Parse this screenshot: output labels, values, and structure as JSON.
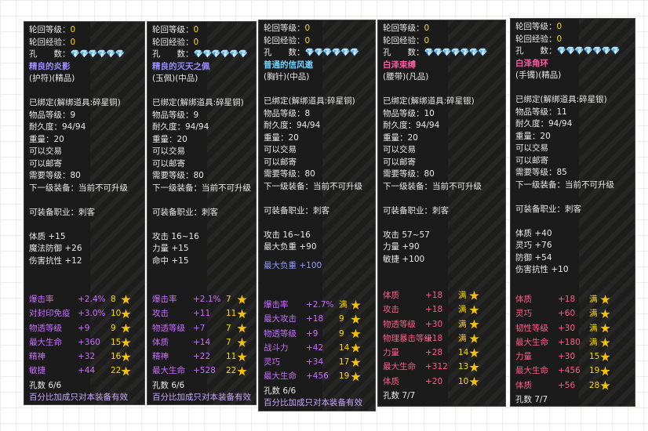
{
  "panels": [
    {
      "lunhui_level": "轮回等级：",
      "lunhui_level_val": "0",
      "lunhui_exp": "轮回经验：",
      "lunhui_exp_val": "0",
      "holes_label": "孔　　数：",
      "holes_stars": "💎💎💎💎💎💎",
      "name": "精良的炎影",
      "name_color": "#9b8cff",
      "type": "(护符)(精品)",
      "lines": [
        "已绑定(解绑道具:碎星铜)",
        "物品等级：9",
        "耐久度：94/94",
        "重量：20",
        "可以交易",
        "可以邮寄",
        "需要等级：80",
        "下一级装备：当前不可升级"
      ],
      "job": "可装备职业：刺客",
      "base": [
        "体质 +15",
        "魔法防御 +26",
        "伤害抗性 +12"
      ],
      "extras": [
        {
          "label": "爆击率",
          "value": "+2.4%",
          "level": "8",
          "color": "#c96bff"
        },
        {
          "label": "对封印免疫",
          "value": "+3.0%",
          "level": "10",
          "color": "#c96bff"
        },
        {
          "label": "物透等级",
          "value": "+9",
          "level": "9",
          "color": "#c96bff"
        },
        {
          "label": "最大生命",
          "value": "+360",
          "level": "15",
          "color": "#c96bff"
        },
        {
          "label": "精神",
          "value": "+32",
          "level": "16",
          "color": "#c96bff"
        },
        {
          "label": "敏捷",
          "value": "+44",
          "level": "22",
          "color": "#c96bff"
        }
      ],
      "holes_count": "孔数 6/6",
      "note": "百分比加成只对本装备有效"
    },
    {
      "lunhui_level": "轮回等级：",
      "lunhui_level_val": "0",
      "lunhui_exp": "轮回经验：",
      "lunhui_exp_val": "0",
      "holes_label": "孔　　数：",
      "holes_stars": "💎💎💎💎💎💎",
      "name": "精良的灭天之佩",
      "name_color": "#9b8cff",
      "type": "(玉佩)(中品)",
      "lines": [
        "已绑定(解绑道具:碎星铜)",
        "物品等级：9",
        "耐久度：94/94",
        "重量：20",
        "可以交易",
        "可以邮寄",
        "需要等级：80",
        "下一级装备：当前不可升级"
      ],
      "job": "可装备职业：刺客",
      "base": [
        "攻击 16~16",
        "力量 +15",
        "命中 +15"
      ],
      "extras": [
        {
          "label": "爆击率",
          "value": "+2.1%",
          "level": "7",
          "color": "#c96bff"
        },
        {
          "label": "攻击",
          "value": "+11",
          "level": "11",
          "color": "#c96bff"
        },
        {
          "label": "物透等级",
          "value": "+7",
          "level": "7",
          "color": "#c96bff"
        },
        {
          "label": "体质",
          "value": "+14",
          "level": "7",
          "color": "#c96bff"
        },
        {
          "label": "精神",
          "value": "+22",
          "level": "11",
          "color": "#c96bff"
        },
        {
          "label": "最大生命",
          "value": "+528",
          "level": "22",
          "color": "#c96bff"
        }
      ],
      "holes_count": "孔数 6/6",
      "note": "百分比加成只对本装备有效"
    },
    {
      "lunhui_level": "轮回等级：",
      "lunhui_level_val": "0",
      "lunhui_exp": "轮回经验：",
      "lunhui_exp_val": "0",
      "holes_label": "孔　　数：",
      "holes_stars": "💎💎💎💎💎💎",
      "name": "普通的信风邀",
      "name_color": "#6fd3ff",
      "type": "(胸针)(中品)",
      "lines": [
        "已绑定(解绑道具:碎星铜)",
        "物品等级：8",
        "耐久度：94/94",
        "重量：20",
        "可以交易",
        "可以邮寄",
        "需要等级：80",
        "下一级装备：当前不可升级"
      ],
      "job": "可装备职业：刺客",
      "base": [
        "攻击 16~16",
        "最大负重 +90"
      ],
      "bonus_line": "最大负重 +100",
      "extras": [
        {
          "label": "爆击率",
          "value": "+2.7%",
          "level": "满",
          "color": "#c96bff"
        },
        {
          "label": "最大攻击",
          "value": "+18",
          "level": "9",
          "color": "#c96bff"
        },
        {
          "label": "物透等级",
          "value": "+9",
          "level": "9",
          "color": "#c96bff"
        },
        {
          "label": "战斗力",
          "value": "+42",
          "level": "14",
          "color": "#c96bff"
        },
        {
          "label": "灵巧",
          "value": "+34",
          "level": "17",
          "color": "#c96bff"
        },
        {
          "label": "最大生命",
          "value": "+456",
          "level": "19",
          "color": "#c96bff"
        }
      ],
      "holes_count": "孔数 6/6",
      "note": "百分比加成只对本装备有效"
    },
    {
      "lunhui_level": "轮回等级：",
      "lunhui_level_val": "0",
      "lunhui_exp": "轮回经验：",
      "lunhui_exp_val": "0",
      "holes_label": "孔　　数：",
      "holes_stars": "💎💎💎💎💎💎💎",
      "name": "白泽束缚",
      "name_color": "#ff5aa6",
      "type": "(腰带)(凡品)",
      "lines": [
        "已绑定(解绑道具:碎星银)",
        "物品等级：10",
        "耐久度：94/94",
        "重量：20",
        "可以交易",
        "可以邮寄",
        "需要等级：80",
        "下一级装备：当前不可升级"
      ],
      "job": "可装备职业：刺客",
      "base": [
        "攻击 57~57",
        "力量 +90",
        "敏捷 +100"
      ],
      "extras": [
        {
          "label": "体质",
          "value": "+18",
          "level": "满",
          "color": "#ff5a8a"
        },
        {
          "label": "攻击",
          "value": "+18",
          "level": "满",
          "color": "#ff5a8a"
        },
        {
          "label": "物透等级",
          "value": "+30",
          "level": "满",
          "color": "#ff5a8a"
        },
        {
          "label": "物理暴击等级",
          "value": "+18",
          "level": "满",
          "color": "#ff5a8a"
        },
        {
          "label": "力量",
          "value": "+28",
          "level": "14",
          "color": "#ff5a8a"
        },
        {
          "label": "最大生命",
          "value": "+312",
          "level": "13",
          "color": "#ff5a8a"
        },
        {
          "label": "体质",
          "value": "+20",
          "level": "10",
          "color": "#ff5a8a"
        }
      ],
      "holes_count": "孔数 7/7",
      "note": ""
    },
    {
      "lunhui_level": "轮回等级：",
      "lunhui_level_val": "0",
      "lunhui_exp": "轮回经验：",
      "lunhui_exp_val": "0",
      "holes_label": "孔　　数：",
      "holes_stars": "💎💎💎💎💎💎💎",
      "name": "白泽角环",
      "name_color": "#ff5aa6",
      "type": "(手镯)(精品)",
      "lines": [
        "已绑定(解绑道具:碎星银)",
        "物品等级：11",
        "耐久度：94/94",
        "重量：20",
        "可以交易",
        "可以邮寄",
        "需要等级：85",
        "下一级装备：当前不可升级"
      ],
      "job": "可装备职业：刺客",
      "base": [
        "体质 +40",
        "灵巧 +76",
        "防御 +54",
        "伤害抗性 +10"
      ],
      "extras": [
        {
          "label": "体质",
          "value": "+18",
          "level": "满",
          "color": "#ff5a8a"
        },
        {
          "label": "灵巧",
          "value": "+60",
          "level": "满",
          "color": "#ff5a8a"
        },
        {
          "label": "韧性等级",
          "value": "+30",
          "level": "满",
          "color": "#ff5a8a"
        },
        {
          "label": "最大生命",
          "value": "+180",
          "level": "满",
          "color": "#ff5a8a"
        },
        {
          "label": "力量",
          "value": "+30",
          "level": "15",
          "color": "#ff5a8a"
        },
        {
          "label": "最大生命",
          "value": "+456",
          "level": "19",
          "color": "#ff5a8a"
        },
        {
          "label": "体质",
          "value": "+56",
          "level": "28",
          "color": "#ff5a8a"
        }
      ],
      "holes_count": "孔数 7/7",
      "note": ""
    }
  ]
}
